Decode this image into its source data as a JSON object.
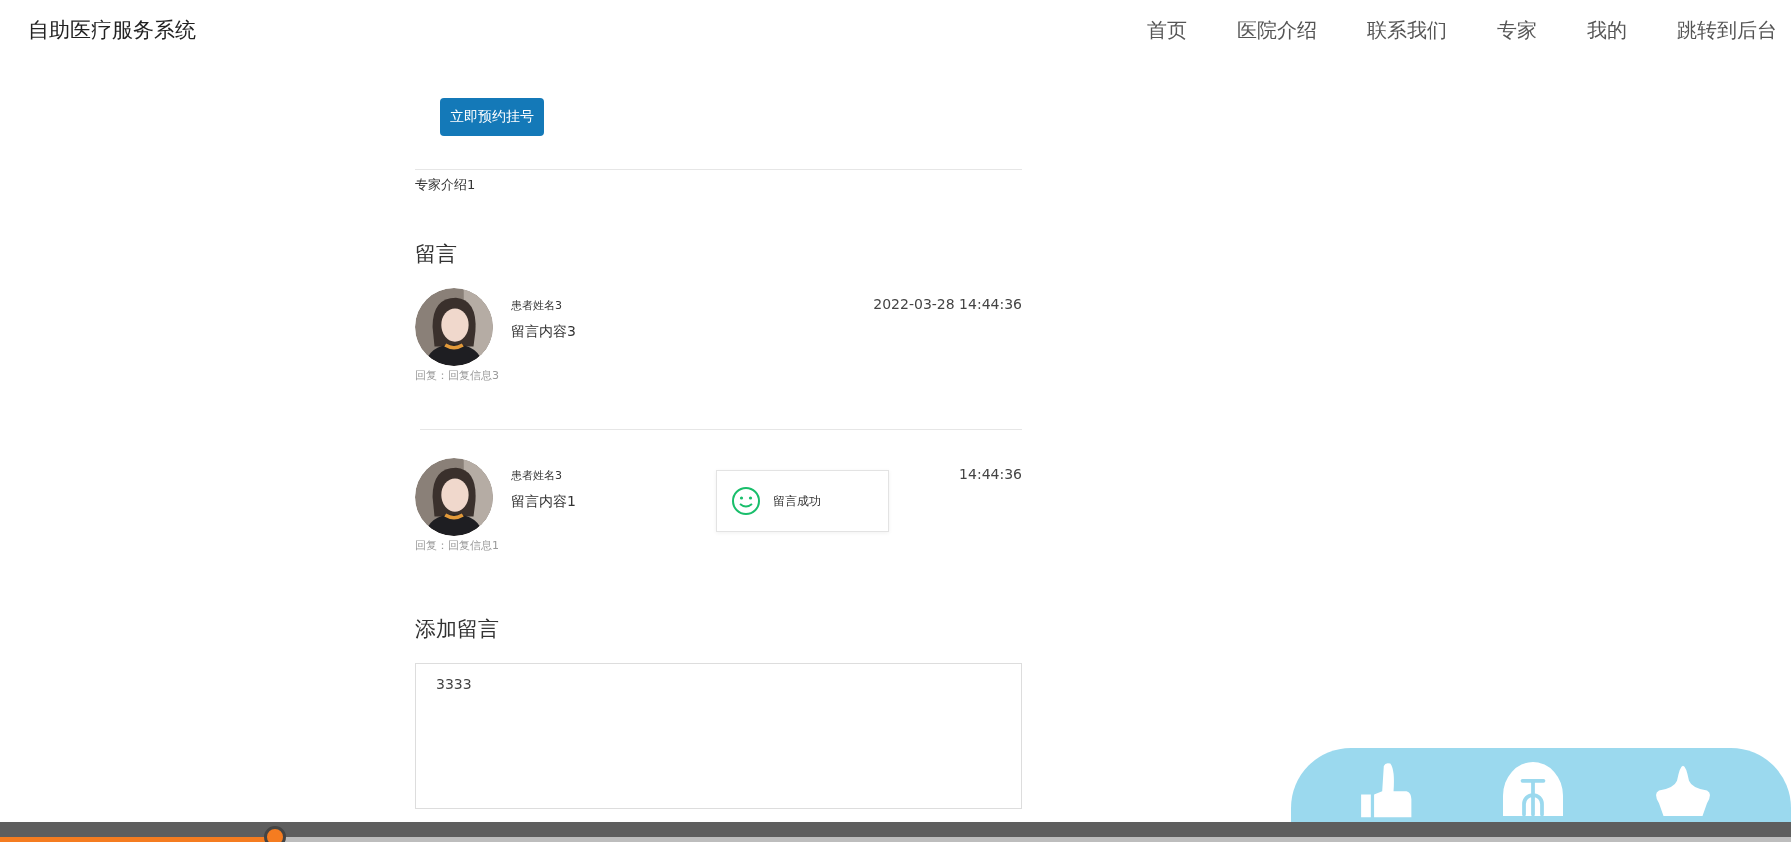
{
  "navbar": {
    "brand": "自助医疗服务系统",
    "links": [
      {
        "label": "首页"
      },
      {
        "label": "医院介绍"
      },
      {
        "label": "联系我们"
      },
      {
        "label": "专家"
      },
      {
        "label": "我的"
      },
      {
        "label": "跳转到后台"
      }
    ]
  },
  "book_button": "立即预约挂号",
  "expert_intro": "专家介绍1",
  "comments_heading": "留言",
  "comments": [
    {
      "name": "患者姓名3",
      "time": "2022-03-28 14:44:36",
      "content": "留言内容3",
      "reply": "回复：回复信息3"
    },
    {
      "name": "患者姓名3",
      "time": "14:44:36",
      "content": "留言内容1",
      "reply": "回复：回复信息1"
    }
  ],
  "toast": {
    "message": "留言成功"
  },
  "add_heading": "添加留言",
  "comment_field": {
    "value": "3333"
  },
  "player": {
    "progress": {
      "level": 0.153
    }
  }
}
